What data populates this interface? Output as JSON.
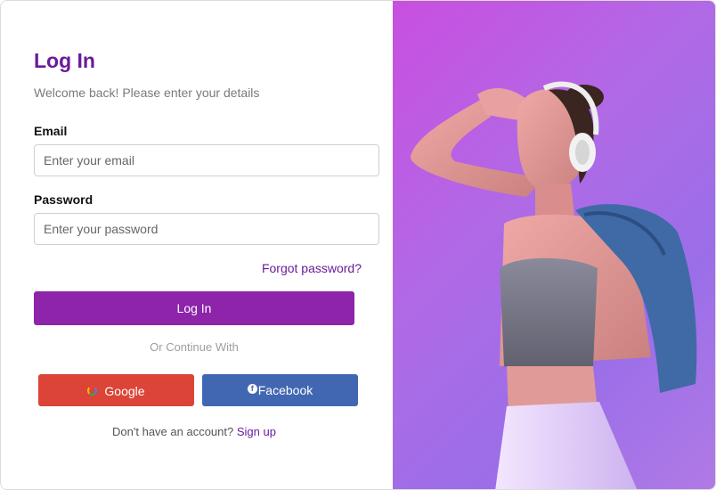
{
  "login": {
    "title": "Log In",
    "subtitle": "Welcome back! Please enter your details",
    "email_label": "Email",
    "email_placeholder": "Enter your email",
    "email_value": "",
    "password_label": "Password",
    "password_placeholder": "Enter your password",
    "password_value": "",
    "forgot_label": "Forgot password?",
    "submit_label": "Log In",
    "divider_text": "Or Continue With",
    "google_label": "Google",
    "facebook_label": "Facebook",
    "no_account_text": "Don't have an account?",
    "signup_label": "Sign up"
  },
  "icons": {
    "google": "google-icon",
    "facebook": "facebook-icon"
  },
  "colors": {
    "accent": "#8e24aa",
    "title": "#6a1b9a",
    "google": "#db4437",
    "facebook": "#4267b2",
    "hero_gradient_start": "#c94fe0",
    "hero_gradient_end": "#9b6ee8"
  },
  "hero_image": {
    "description_icon": "woman-with-headphones-photo"
  }
}
